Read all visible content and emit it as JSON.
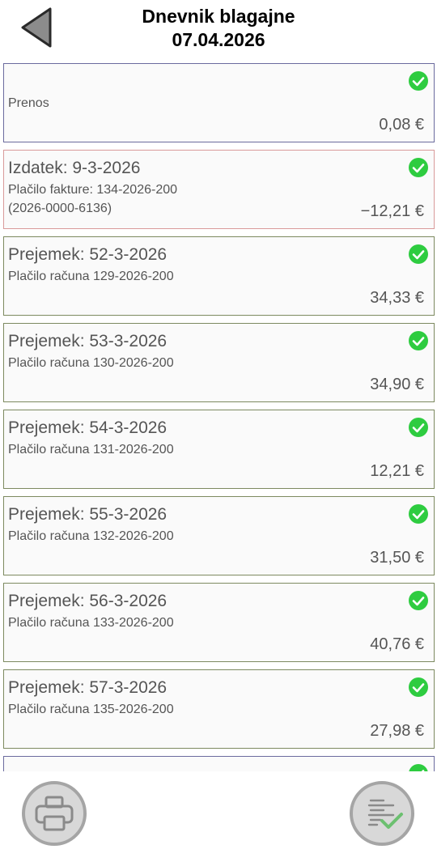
{
  "header": {
    "title": "Dnevnik blagajne",
    "date": "07.04.2026"
  },
  "entries": [
    {
      "heading": "",
      "description": "Prenos",
      "amount": "0,08 €",
      "status": "confirmed"
    },
    {
      "heading": "Izdatek: 9-3-2026",
      "description": "Plačilo fakture: 134-2026-200\n(2026-0000-6136)",
      "amount": "−12,21 €",
      "status": "confirmed"
    },
    {
      "heading": "Prejemek: 52-3-2026",
      "description": "Plačilo računa 129-2026-200",
      "amount": "34,33 €",
      "status": "confirmed"
    },
    {
      "heading": "Prejemek: 53-3-2026",
      "description": "Plačilo računa 130-2026-200",
      "amount": "34,90 €",
      "status": "confirmed"
    },
    {
      "heading": "Prejemek: 54-3-2026",
      "description": "Plačilo računa 131-2026-200",
      "amount": "12,21 €",
      "status": "confirmed"
    },
    {
      "heading": "Prejemek: 55-3-2026",
      "description": "Plačilo računa 132-2026-200",
      "amount": "31,50 €",
      "status": "confirmed"
    },
    {
      "heading": "Prejemek: 56-3-2026",
      "description": "Plačilo računa 133-2026-200",
      "amount": "40,76 €",
      "status": "confirmed"
    },
    {
      "heading": "Prejemek: 57-3-2026",
      "description": "Plačilo računa 135-2026-200",
      "amount": "27,98 €",
      "status": "confirmed"
    }
  ],
  "colors": {
    "check_green": "#2ecc40",
    "icon_gray": "#8a8a8a"
  },
  "icons": {
    "back": "back-arrow-icon",
    "check": "check-circle-icon",
    "print": "printer-icon",
    "confirm": "list-check-icon"
  }
}
